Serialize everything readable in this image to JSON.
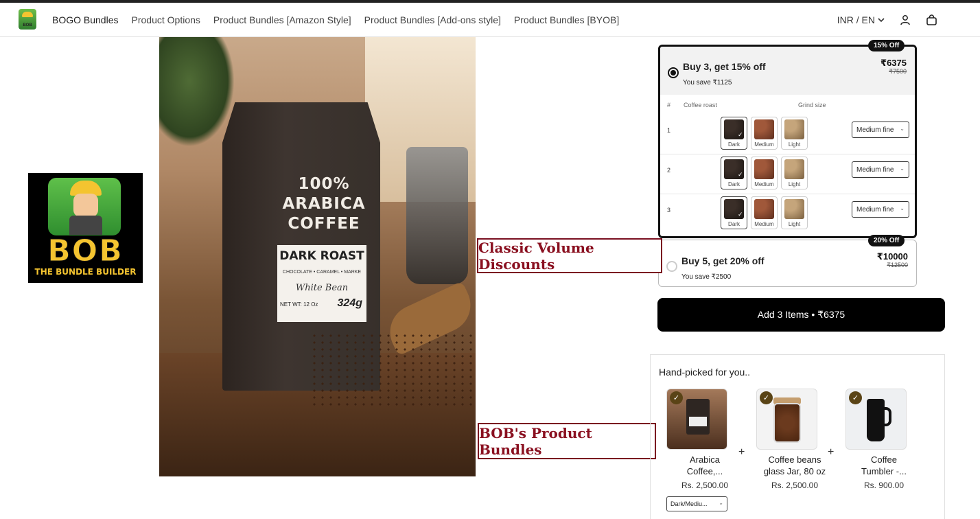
{
  "header": {
    "logo_text": "BOB",
    "nav": [
      "BOGO Bundles",
      "Product Options",
      "Product Bundles [Amazon Style]",
      "Product Bundles [Add-ons style]",
      "Product Bundles [BYOB]"
    ],
    "locale": "INR / EN",
    "icons": [
      "chevron-down-icon",
      "user-icon",
      "bag-icon"
    ]
  },
  "bob_logo": {
    "title": "BOB",
    "subtitle": "THE BUNDLE BUILDER"
  },
  "product_image": {
    "bag_title": "100%\nARABICA\nCOFFEE",
    "label_title": "DARK ROAST",
    "label_notes": "CHOCOLATE • CARAMEL • MARKE",
    "label_script": "White Bean",
    "net_wt": "NET WT: 12 Oz",
    "grams": "324g"
  },
  "annotations": {
    "classic": "Classic Volume Discounts",
    "bob": "BOB's Product Bundles"
  },
  "offers": [
    {
      "badge": "15% Off",
      "title": "Buy 3, get 15% off",
      "save": "You save ₹1125",
      "price": "₹6375",
      "old_price": "₹7500",
      "selected": true
    },
    {
      "badge": "20% Off",
      "title": "Buy 5, get 20% off",
      "save": "You save ₹2500",
      "price": "₹10000",
      "old_price": "₹12500",
      "selected": false
    }
  ],
  "variant_grid": {
    "headers": {
      "num": "#",
      "roast": "Coffee roast",
      "grind": "Grind size"
    },
    "roast_options": [
      "Dark",
      "Medium",
      "Light"
    ],
    "rows": [
      {
        "num": "1",
        "selected_roast": "Dark",
        "grind": "Medium fine"
      },
      {
        "num": "2",
        "selected_roast": "Dark",
        "grind": "Medium fine"
      },
      {
        "num": "3",
        "selected_roast": "Dark",
        "grind": "Medium fine"
      }
    ]
  },
  "add_button": "Add 3 Items • ₹6375",
  "handpicked": {
    "title": "Hand-picked for you..",
    "items": [
      {
        "name": "Arabica Coffee,...",
        "price": "Rs. 2,500.00"
      },
      {
        "name": "Coffee beans glass Jar, 80 oz",
        "price": "Rs. 2,500.00"
      },
      {
        "name": "Coffee Tumbler -...",
        "price": "Rs. 900.00"
      }
    ],
    "plus": "+",
    "variant_select": "Dark/Mediu..."
  },
  "colors": {
    "accent": "#000000",
    "annotation": "#8a1020",
    "check": "#5a4416"
  }
}
